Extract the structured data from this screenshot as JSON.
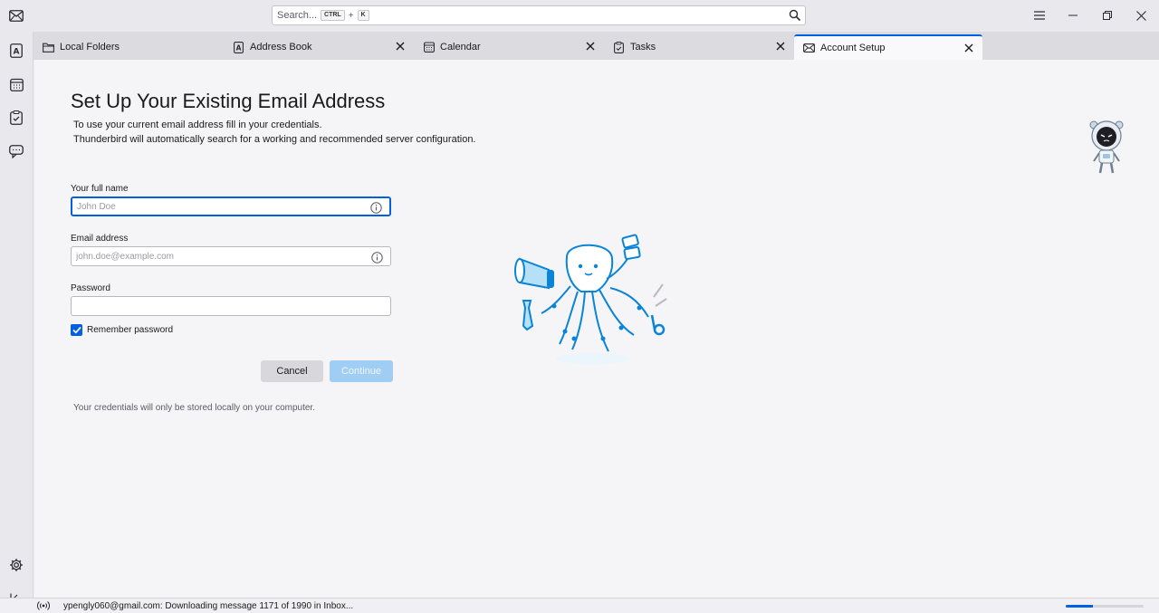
{
  "search": {
    "placeholder": "Search...",
    "shortcut_ctrl": "CTRL",
    "shortcut_plus": "+",
    "shortcut_key": "K"
  },
  "tabs": [
    {
      "label": "Local Folders",
      "icon": "folder-icon",
      "closable": false
    },
    {
      "label": "Address Book",
      "icon": "address-book-icon",
      "closable": true
    },
    {
      "label": "Calendar",
      "icon": "calendar-icon",
      "closable": true
    },
    {
      "label": "Tasks",
      "icon": "tasks-icon",
      "closable": true
    },
    {
      "label": "Account Setup",
      "icon": "mail-icon",
      "closable": true,
      "active": true
    }
  ],
  "page": {
    "title": "Set Up Your Existing Email Address",
    "desc_line1": "To use your current email address fill in your credentials.",
    "desc_line2": "Thunderbird will automatically search for a working and recommended server configuration."
  },
  "form": {
    "name_label": "Your full name",
    "name_placeholder": "John Doe",
    "email_label": "Email address",
    "email_placeholder": "john.doe@example.com",
    "password_label": "Password",
    "password_value": "",
    "remember_label": "Remember password",
    "remember_checked": true,
    "cancel_label": "Cancel",
    "continue_label": "Continue",
    "note": "Your credentials will only be stored locally on your computer."
  },
  "status": {
    "text": "ypengly060@gmail.com: Downloading message 1171 of 1990 in Inbox...",
    "progress_fraction": 0.35
  },
  "colors": {
    "accent": "#0060df",
    "continue_disabled": "#9fcdf4"
  }
}
